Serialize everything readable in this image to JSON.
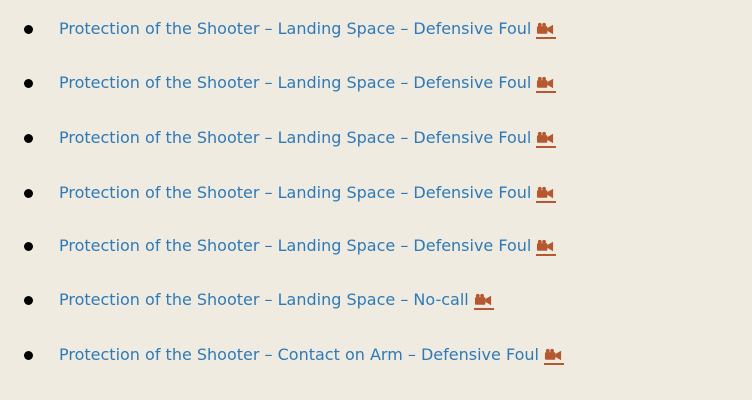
{
  "items": [
    {
      "text": "Protection of the Shooter –  Landing Space – Defensive Foul"
    },
    {
      "text": "Protection of the Shooter –  Landing Space – Defensive Foul"
    },
    {
      "text": "Protection of the Shooter –  Landing Space – Defensive Foul"
    },
    {
      "text": "Protection of the Shooter –  Landing Space – Defensive Foul"
    },
    {
      "text": "Protection of the Shooter –  Landing Space – Defensive Foul"
    },
    {
      "text": "Protection of the Shooter –  Landing Space – No-call"
    },
    {
      "text": "Protection of the Shooter –  Contact on Arm – Defensive Foul"
    }
  ],
  "icons": {
    "video": "video-camera-icon"
  },
  "colors": {
    "text": "#2e7ab8",
    "background": "#efebe0",
    "bullet": "#000000",
    "camera_icon": "#b5582f"
  }
}
